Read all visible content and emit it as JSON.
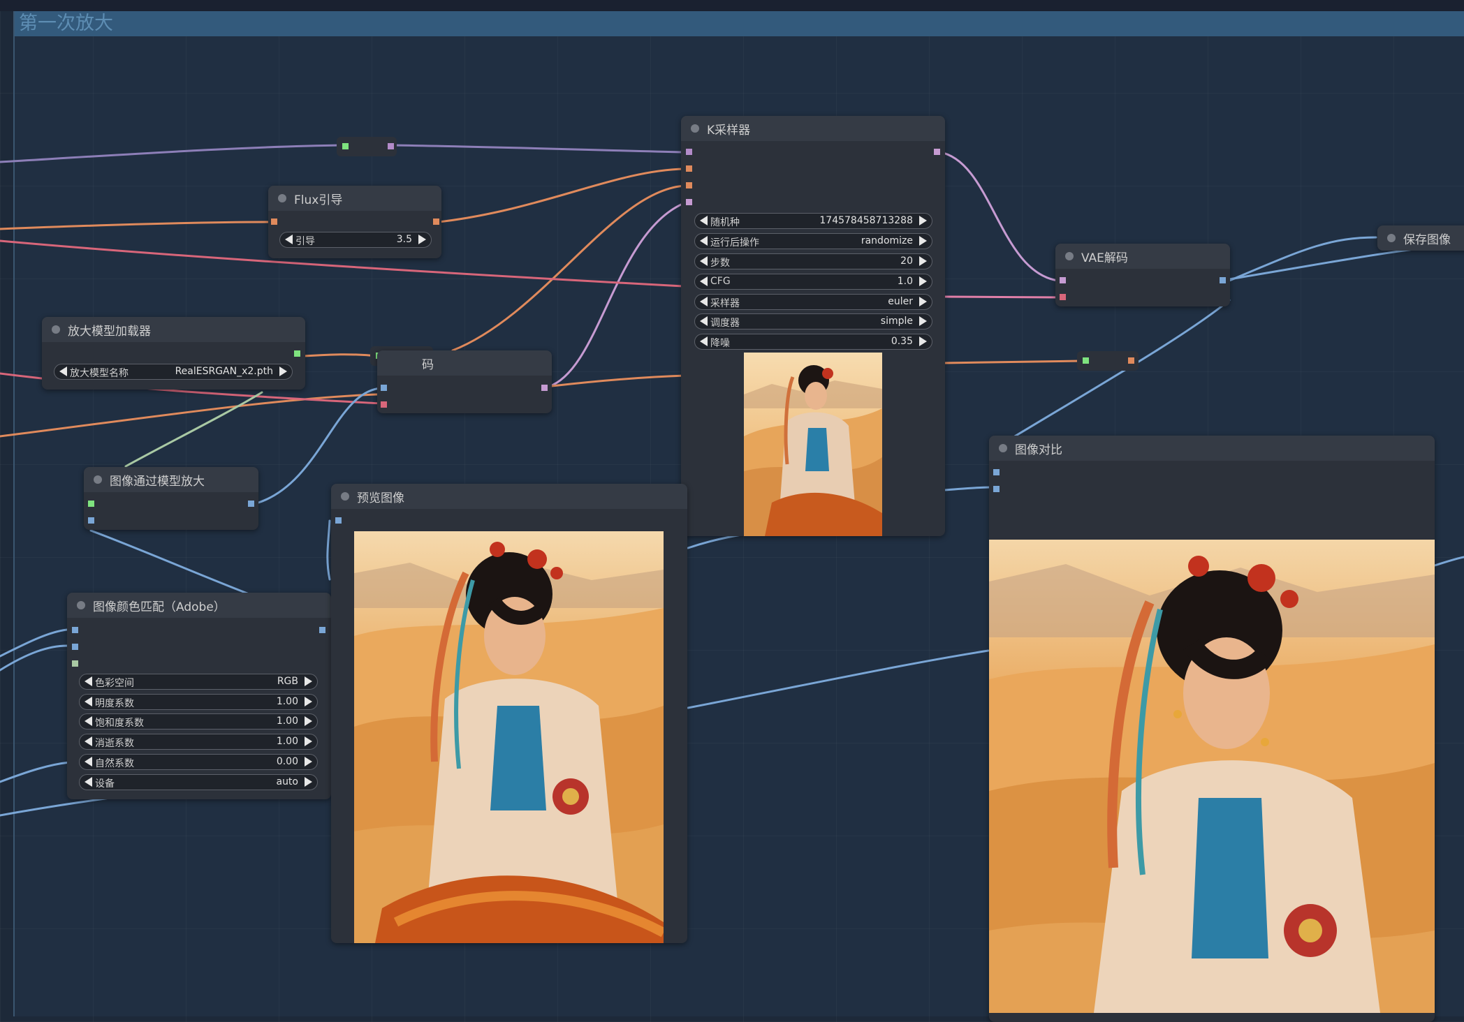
{
  "group": {
    "title": "第一次放大"
  },
  "nodes": {
    "ksampler": {
      "title": "K采样器",
      "widgets": [
        {
          "label": "随机种",
          "value": "174578458713288"
        },
        {
          "label": "运行后操作",
          "value": "randomize"
        },
        {
          "label": "步数",
          "value": "20"
        },
        {
          "label": "CFG",
          "value": "1.0"
        },
        {
          "label": "采样器",
          "value": "euler"
        },
        {
          "label": "调度器",
          "value": "simple"
        },
        {
          "label": "降噪",
          "value": "0.35"
        }
      ]
    },
    "flux_guidance": {
      "title": "Flux引导",
      "widgets": [
        {
          "label": "引导",
          "value": "3.5"
        }
      ]
    },
    "upscale_loader": {
      "title": "放大模型加载器",
      "widgets": [
        {
          "label": "放大模型名称",
          "value": "RealESRGAN_x2.pth"
        }
      ]
    },
    "vae_encode": {
      "title": "码"
    },
    "image_upscale": {
      "title": "图像通过模型放大"
    },
    "preview": {
      "title": "预览图像"
    },
    "vae_decode": {
      "title": "VAE解码"
    },
    "save_image": {
      "title": "保存图像"
    },
    "compare": {
      "title": "图像对比"
    },
    "color_match": {
      "title": "图像颜色匹配（Adobe）",
      "widgets": [
        {
          "label": "色彩空间",
          "value": "RGB"
        },
        {
          "label": "明度系数",
          "value": "1.00"
        },
        {
          "label": "饱和度系数",
          "value": "1.00"
        },
        {
          "label": "消逝系数",
          "value": "1.00"
        },
        {
          "label": "自然系数",
          "value": "0.00"
        },
        {
          "label": "设备",
          "value": "auto"
        }
      ]
    }
  },
  "colors": {
    "canvas_bg": "#1d2939",
    "node_bg": "#2c313a",
    "model_wire": "#b38bc9",
    "conditioning_wire": "#e08a5c",
    "latent_wire": "#e07fa8",
    "image_wire": "#7aa6d6",
    "upscale_model_wire": "#a9c9a4"
  }
}
